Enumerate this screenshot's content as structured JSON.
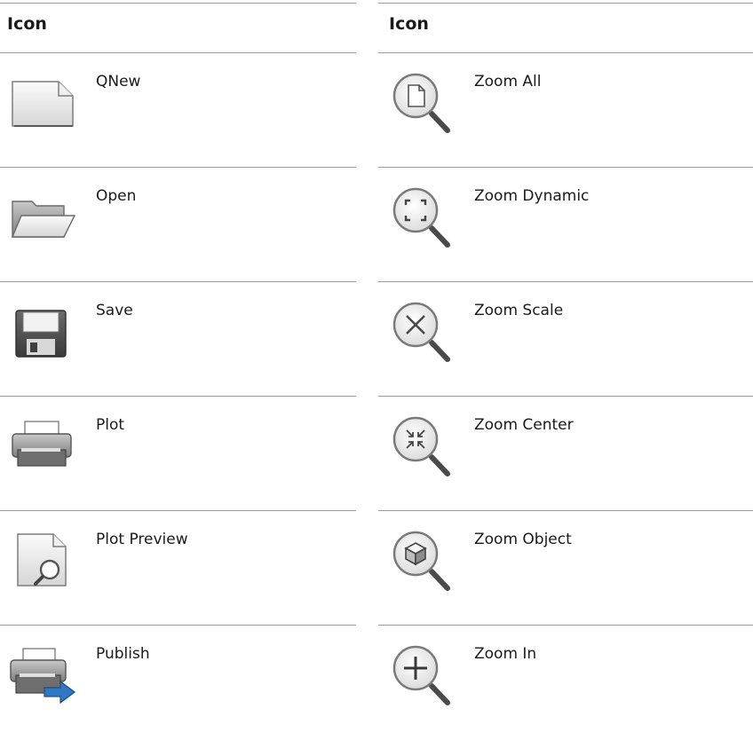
{
  "headers": {
    "left": "Icon",
    "right": "Icon"
  },
  "rows": [
    {
      "left": {
        "label": "QNew",
        "icon": "qnew-icon"
      },
      "right": {
        "label": "Zoom All",
        "icon": "zoom-all-icon"
      }
    },
    {
      "left": {
        "label": "Open",
        "icon": "open-folder-icon"
      },
      "right": {
        "label": "Zoom Dynamic",
        "icon": "zoom-dynamic-icon"
      }
    },
    {
      "left": {
        "label": "Save",
        "icon": "save-floppy-icon"
      },
      "right": {
        "label": "Zoom Scale",
        "icon": "zoom-scale-icon"
      }
    },
    {
      "left": {
        "label": "Plot",
        "icon": "plot-printer-icon"
      },
      "right": {
        "label": "Zoom Center",
        "icon": "zoom-center-icon"
      }
    },
    {
      "left": {
        "label": "Plot Preview",
        "icon": "plot-preview-icon"
      },
      "right": {
        "label": "Zoom Object",
        "icon": "zoom-object-icon"
      }
    },
    {
      "left": {
        "label": "Publish",
        "icon": "publish-icon"
      },
      "right": {
        "label": "Zoom In",
        "icon": "zoom-in-icon"
      }
    }
  ],
  "colors": {
    "rule": "#9a9a9a",
    "text": "#1a1a1a",
    "accent_blue": "#2f78c4"
  }
}
